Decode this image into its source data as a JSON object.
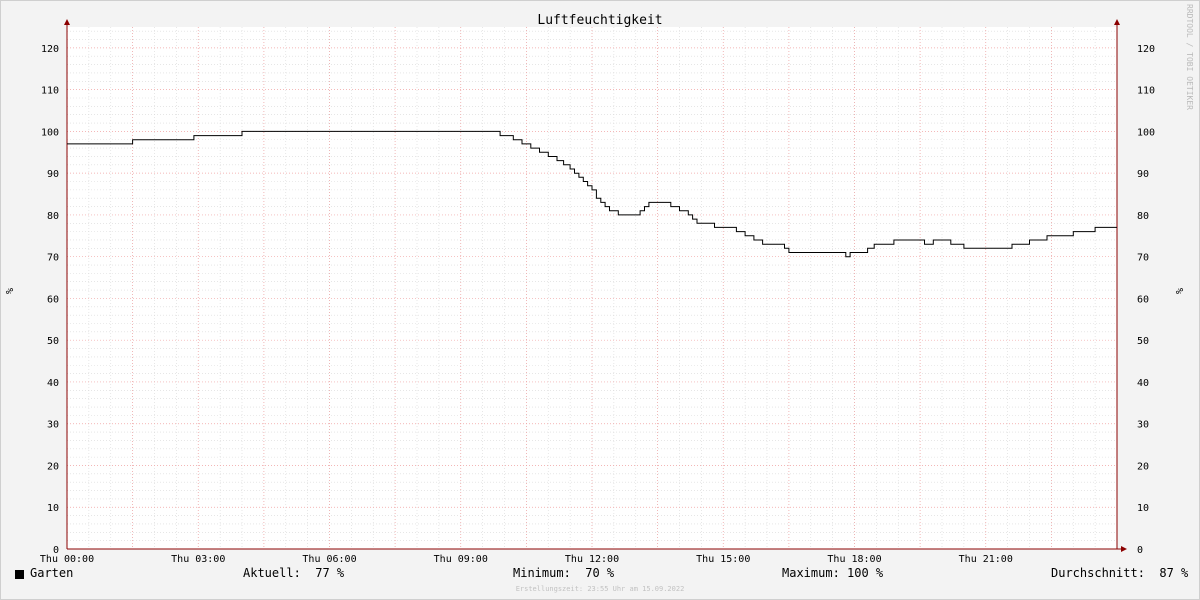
{
  "chart_data": {
    "type": "line",
    "title": "Luftfeuchtigkeit",
    "ylabel": "%",
    "ylim": [
      0,
      125
    ],
    "y_ticks": [
      0,
      10,
      20,
      30,
      40,
      50,
      60,
      70,
      80,
      90,
      100,
      110,
      120
    ],
    "xlim": [
      0,
      24
    ],
    "x_ticks": [
      {
        "x": 0,
        "label": "Thu 00:00"
      },
      {
        "x": 3,
        "label": "Thu 03:00"
      },
      {
        "x": 6,
        "label": "Thu 06:00"
      },
      {
        "x": 9,
        "label": "Thu 09:00"
      },
      {
        "x": 12,
        "label": "Thu 12:00"
      },
      {
        "x": 15,
        "label": "Thu 15:00"
      },
      {
        "x": 18,
        "label": "Thu 18:00"
      },
      {
        "x": 21,
        "label": "Thu 21:00"
      }
    ],
    "grid": true,
    "series": [
      {
        "name": "Garten",
        "color": "#000000",
        "x": [
          0,
          1.5,
          2.9,
          3.0,
          4.0,
          9.9,
          10.2,
          10.4,
          10.6,
          10.8,
          11.0,
          11.2,
          11.35,
          11.5,
          11.6,
          11.7,
          11.8,
          11.9,
          12.0,
          12.1,
          12.2,
          12.3,
          12.4,
          12.5,
          12.6,
          12.7,
          12.8,
          12.9,
          13.1,
          13.2,
          13.3,
          13.5,
          13.8,
          14.0,
          14.2,
          14.3,
          14.4,
          14.6,
          14.8,
          15.3,
          15.5,
          15.7,
          15.9,
          16.3,
          16.4,
          16.5,
          17.8,
          17.85,
          17.9,
          18.3,
          18.45,
          18.9,
          19.6,
          19.8,
          20.2,
          20.5,
          21.0,
          21.6,
          22.0,
          22.4,
          23.0,
          23.5,
          24.0
        ],
        "y": [
          97,
          98,
          99,
          99,
          100,
          99,
          98,
          97,
          96,
          95,
          94,
          93,
          92,
          91,
          90,
          89,
          88,
          87,
          86,
          84,
          83,
          82,
          81,
          81,
          80,
          80,
          80,
          80,
          81,
          82,
          83,
          83,
          82,
          81,
          80,
          79,
          78,
          78,
          77,
          76,
          75,
          74,
          73,
          73,
          72,
          71,
          70,
          70,
          71,
          72,
          73,
          74,
          73,
          74,
          73,
          72,
          72,
          73,
          74,
          75,
          76,
          77,
          77
        ]
      }
    ]
  },
  "legend": {
    "series_label": "Garten",
    "aktuell": "Aktuell:  77 %",
    "minimum": "Minimum:  70 %",
    "maximum": "Maximum: 100 %",
    "durchschnitt": "Durchschnitt:  87 %"
  },
  "footer": "Erstellungszeit: 23:55 Uhr am 15.09.2022",
  "watermark": "RRDTOOL / TOBI OETIKER"
}
